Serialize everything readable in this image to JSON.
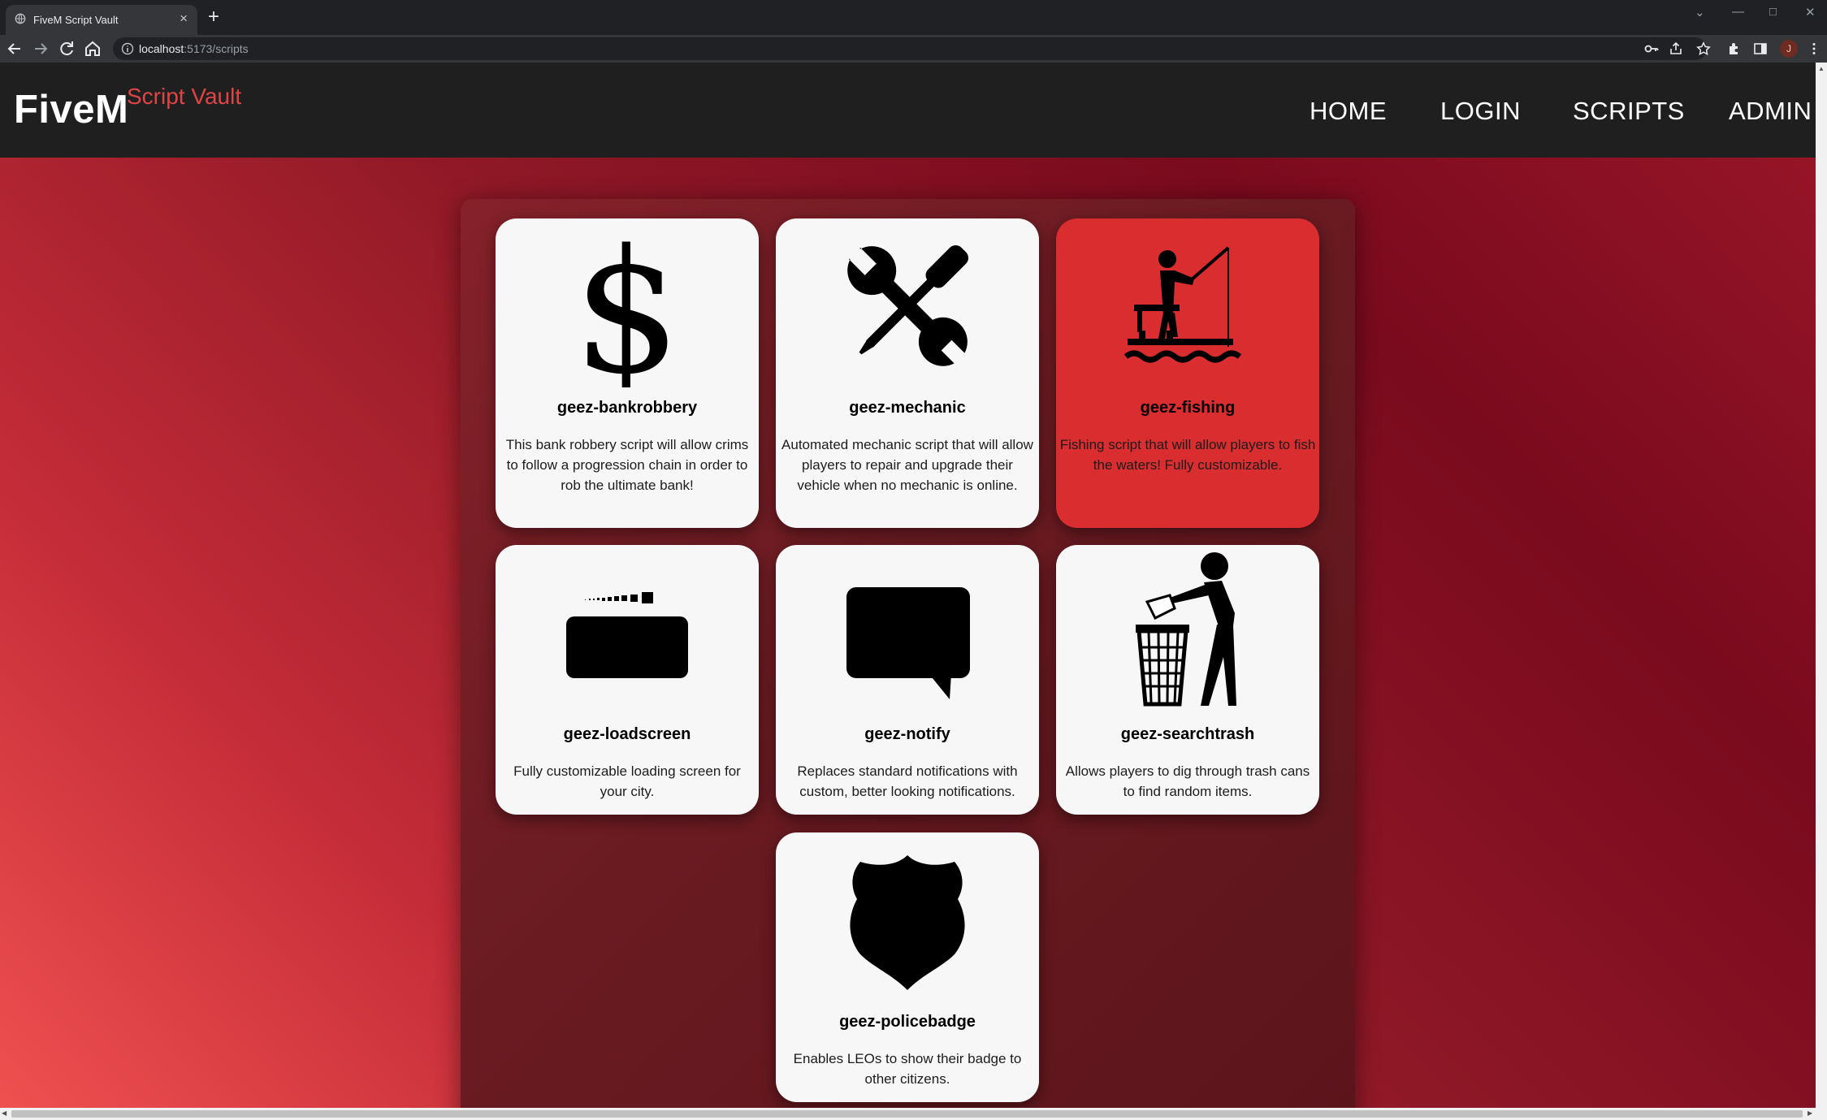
{
  "browser": {
    "tab_title": "FiveM Script Vault",
    "url_host": "localhost",
    "url_path": ":5173/scripts",
    "profile_initial": "J"
  },
  "site": {
    "brand_main": "FiveM",
    "brand_sub": "Script Vault",
    "nav": [
      "HOME",
      "LOGIN",
      "SCRIPTS",
      "ADMIN"
    ]
  },
  "scripts": [
    {
      "name": "geez-bankrobbery",
      "icon": "dollar-icon",
      "description": "This bank robbery script will allow crims to follow a progression chain in order to rob the ultimate bank!"
    },
    {
      "name": "geez-mechanic",
      "icon": "wrench-screwdriver-icon",
      "description": "Automated mechanic script that will allow players to repair and upgrade their vehicle when no mechanic is online."
    },
    {
      "name": "geez-fishing",
      "icon": "fishing-icon",
      "description": "Fishing script that will allow players to fish the waters! Fully customizable.",
      "highlighted": true
    },
    {
      "name": "geez-loadscreen",
      "icon": "loading-bar-icon",
      "description": "Fully customizable loading screen for your city."
    },
    {
      "name": "geez-notify",
      "icon": "speech-bubble-icon",
      "description": "Replaces standard notifications with custom, better looking notifications."
    },
    {
      "name": "geez-searchtrash",
      "icon": "trash-person-icon",
      "description": "Allows players to dig through trash cans to find random items."
    },
    {
      "name": "geez-policebadge",
      "icon": "police-badge-icon",
      "description": "Enables LEOs to show their badge to other citizens."
    }
  ],
  "colors": {
    "navbar": "#1f1f1f",
    "brand_accent": "#e04545",
    "highlight_card": "#d92d30",
    "card": "#f7f7f7"
  }
}
